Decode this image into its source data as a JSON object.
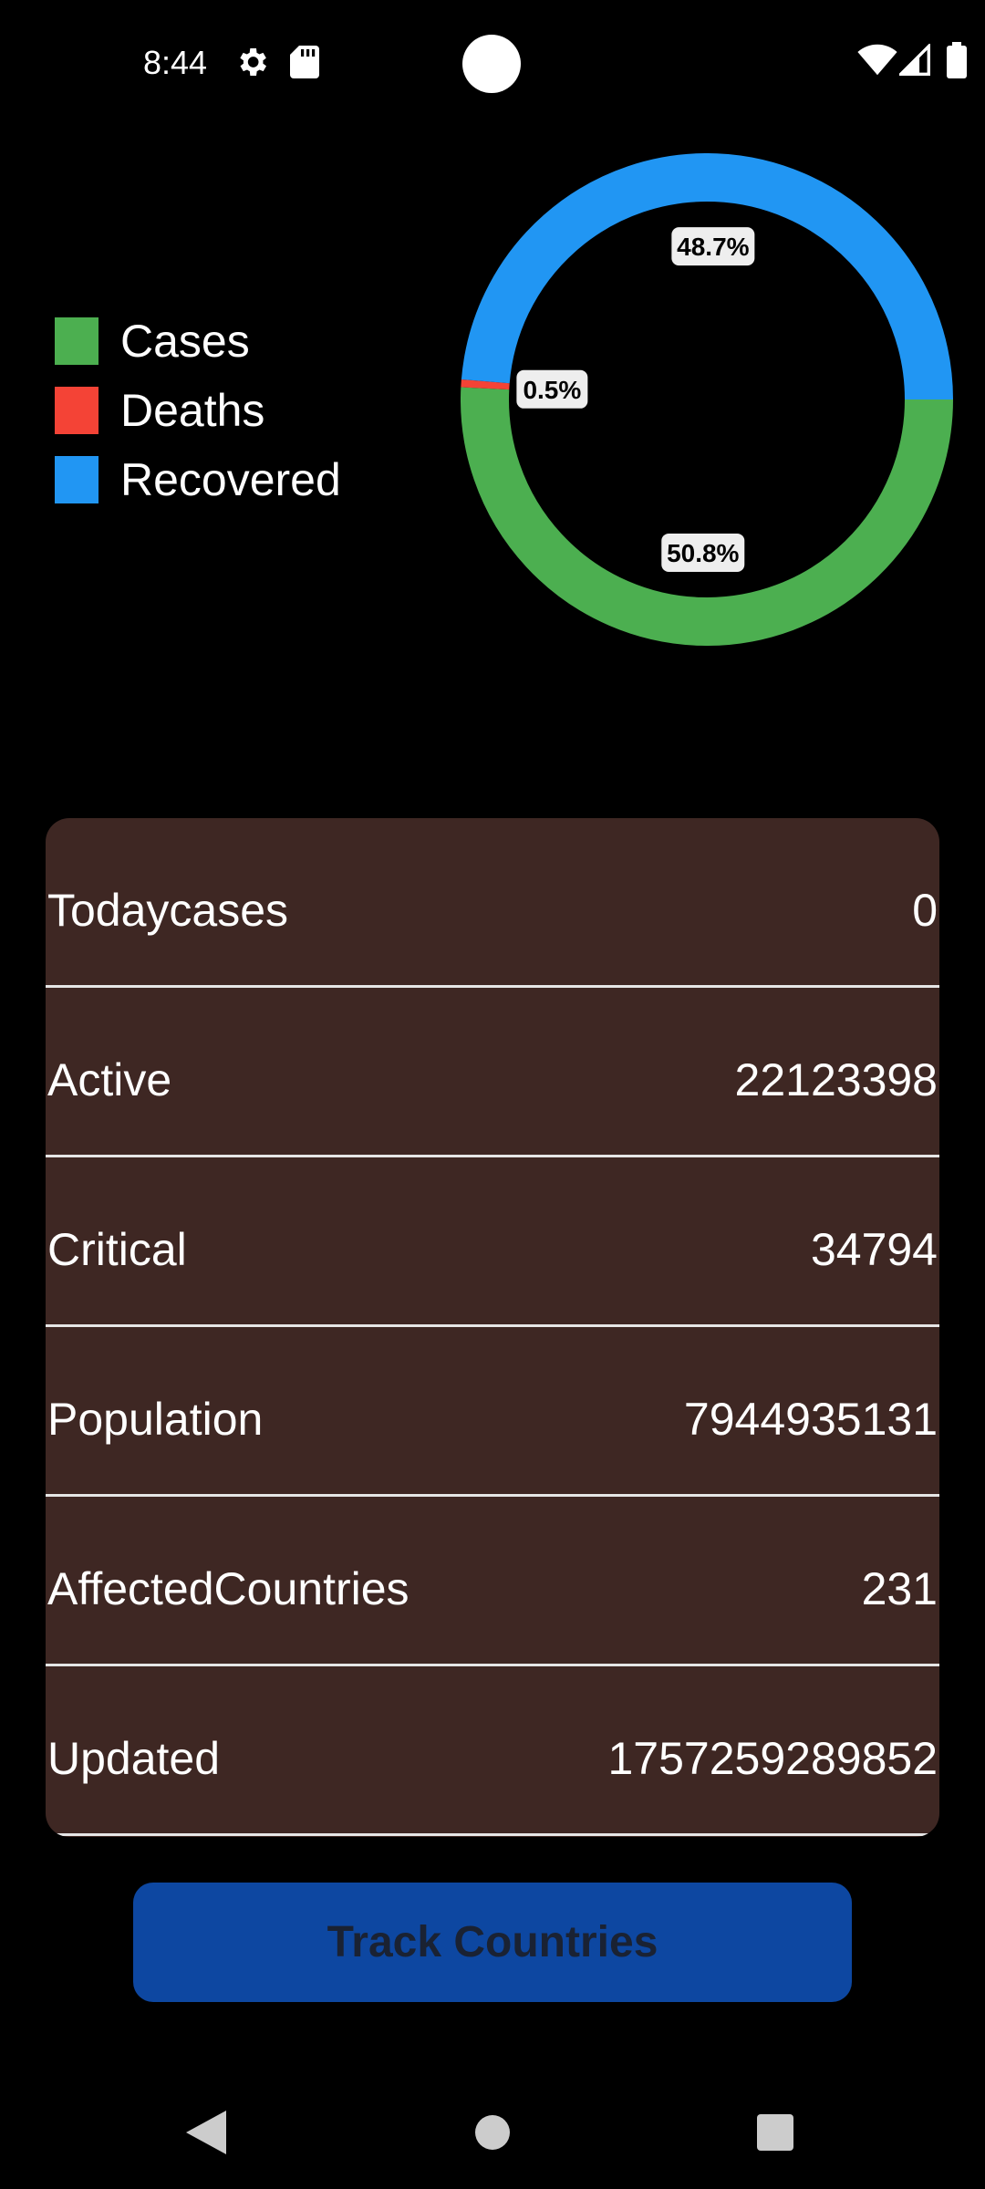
{
  "status_bar": {
    "time": "8:44",
    "icons": [
      "gear-icon",
      "sd-card-icon",
      "wifi-icon",
      "signal-icon",
      "battery-icon"
    ]
  },
  "legend": [
    {
      "label": "Cases",
      "color": "#4caf50"
    },
    {
      "label": "Deaths",
      "color": "#f44336"
    },
    {
      "label": "Recovered",
      "color": "#2196f3"
    }
  ],
  "chart_data": {
    "type": "pie",
    "labels": [
      "Cases",
      "Deaths",
      "Recovered"
    ],
    "values": [
      50.8,
      0.5,
      48.7
    ],
    "value_labels": [
      "50.8%",
      "0.5%",
      "48.7%"
    ],
    "colors": [
      "#4caf50",
      "#f44336",
      "#2196f3"
    ],
    "donut": true,
    "legend_position": "left"
  },
  "stats": [
    {
      "label": "Todaycases",
      "value": "0"
    },
    {
      "label": "Active",
      "value": "22123398"
    },
    {
      "label": "Critical",
      "value": "34794"
    },
    {
      "label": "Population",
      "value": "7944935131"
    },
    {
      "label": "AffectedCountries",
      "value": "231"
    },
    {
      "label": "Updated",
      "value": "1757259289852"
    }
  ],
  "button": {
    "label": "Track Countries"
  },
  "nav_bar": {
    "icons": [
      "back-icon",
      "home-icon",
      "recents-icon"
    ]
  }
}
